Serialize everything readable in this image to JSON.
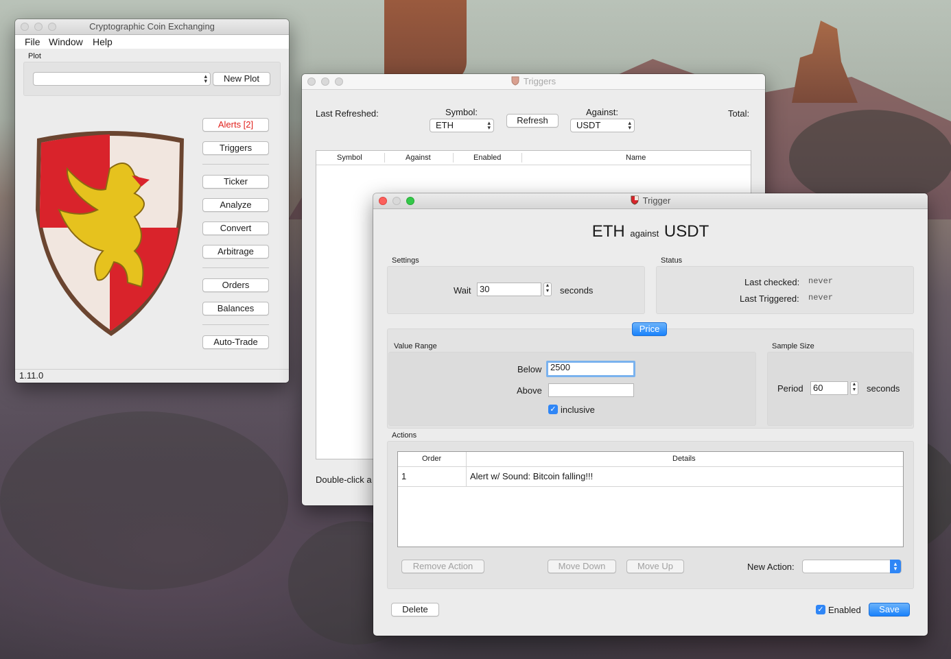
{
  "main_window": {
    "title": "Cryptographic Coin Exchanging",
    "menu": [
      "File",
      "Window",
      "Help"
    ],
    "plot_label": "Plot",
    "plot_select_value": "",
    "new_plot": "New Plot",
    "buttons": [
      "Alerts [2]",
      "Triggers",
      "Ticker",
      "Analyze",
      "Convert",
      "Arbitrage",
      "Orders",
      "Balances",
      "Auto-Trade"
    ],
    "version": "1.11.0",
    "colors": {
      "alert_text": "#e0201b",
      "shield_red": "#d9232b",
      "shield_white": "#f1e6df",
      "griffin": "#e6c21e"
    }
  },
  "triggers_window": {
    "title": "Triggers",
    "last_refreshed_label": "Last Refreshed:",
    "symbol_label": "Symbol:",
    "symbol_value": "ETH",
    "refresh": "Refresh",
    "against_label": "Against:",
    "against_value": "USDT",
    "total_label": "Total:",
    "columns": [
      "Symbol",
      "Against",
      "Enabled",
      "Name"
    ],
    "footer_text": "Double-click a"
  },
  "trigger_window": {
    "title": "Trigger",
    "heading_symbol": "ETH",
    "heading_against": "against",
    "heading_quote": "USDT",
    "settings_label": "Settings",
    "wait_label": "Wait",
    "wait_value": "30",
    "seconds_1": "seconds",
    "status_label": "Status",
    "last_checked_label": "Last checked:",
    "last_checked_value": "never",
    "last_triggered_label": "Last Triggered:",
    "last_triggered_value": "never",
    "price_tab": "Price",
    "value_range_label": "Value Range",
    "below_label": "Below",
    "below_value": "2500",
    "above_label": "Above",
    "above_value": "",
    "inclusive_label": "inclusive",
    "sample_size_label": "Sample Size",
    "period_label": "Period",
    "period_value": "60",
    "seconds_2": "seconds",
    "actions_label": "Actions",
    "action_columns": [
      "Order",
      "Details"
    ],
    "actions": [
      {
        "order": "1",
        "details": "Alert w/ Sound: Bitcoin falling!!!"
      }
    ],
    "remove_action": "Remove Action",
    "move_down": "Move Down",
    "move_up": "Move Up",
    "new_action_label": "New Action:",
    "new_action_value": "",
    "delete": "Delete",
    "enabled_label": "Enabled",
    "save": "Save",
    "colors": {
      "accent": "#2f86f6"
    }
  }
}
